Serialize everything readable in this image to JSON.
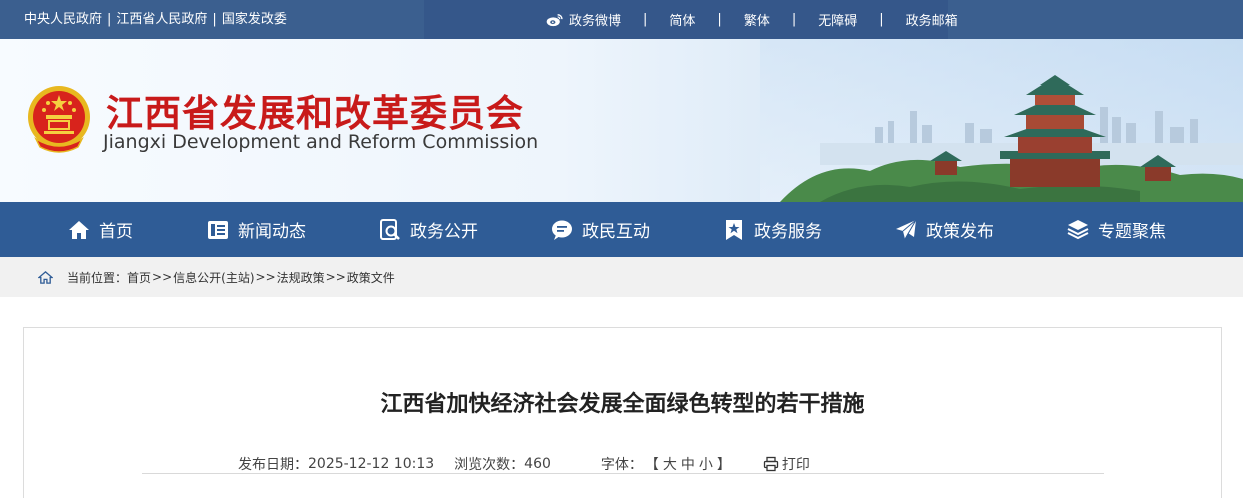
{
  "top_links": {
    "left": [
      "中央人民政府",
      "江西省人民政府",
      "国家发改委"
    ],
    "separator": "|",
    "right": [
      "政务微博",
      "简体",
      "繁体",
      "无障碍",
      "政务邮箱"
    ]
  },
  "header": {
    "title": "江西省发展和改革委员会",
    "subtitle": "Jiangxi Development and Reform Commission"
  },
  "nav": [
    {
      "label": "首页",
      "icon": "home-icon"
    },
    {
      "label": "新闻动态",
      "icon": "news-icon"
    },
    {
      "label": "政务公开",
      "icon": "search-doc-icon"
    },
    {
      "label": "政民互动",
      "icon": "chat-icon"
    },
    {
      "label": "政务服务",
      "icon": "bookmark-star-icon"
    },
    {
      "label": "政策发布",
      "icon": "paper-plane-icon"
    },
    {
      "label": "专题聚焦",
      "icon": "layers-icon"
    }
  ],
  "breadcrumb": {
    "prefix": "当前位置：",
    "items": [
      "首页",
      "信息公开(主站)",
      "法规政策",
      "政策文件"
    ],
    "separator": ">>"
  },
  "article": {
    "title": "江西省加快经济社会发展全面绿色转型的若干措施",
    "date_label": "发布日期：",
    "date": "2025-12-12 10:13",
    "views_label": "浏览次数：",
    "views": "460",
    "font_label": "字体：",
    "bracket_open": "【",
    "font_large": "大",
    "font_medium": "中",
    "font_small": "小",
    "bracket_close": "】",
    "print_label": "打印"
  },
  "colors": {
    "topbar": "#3b5f8f",
    "nav": "#2f5c96",
    "title_red": "#c81a1a"
  }
}
